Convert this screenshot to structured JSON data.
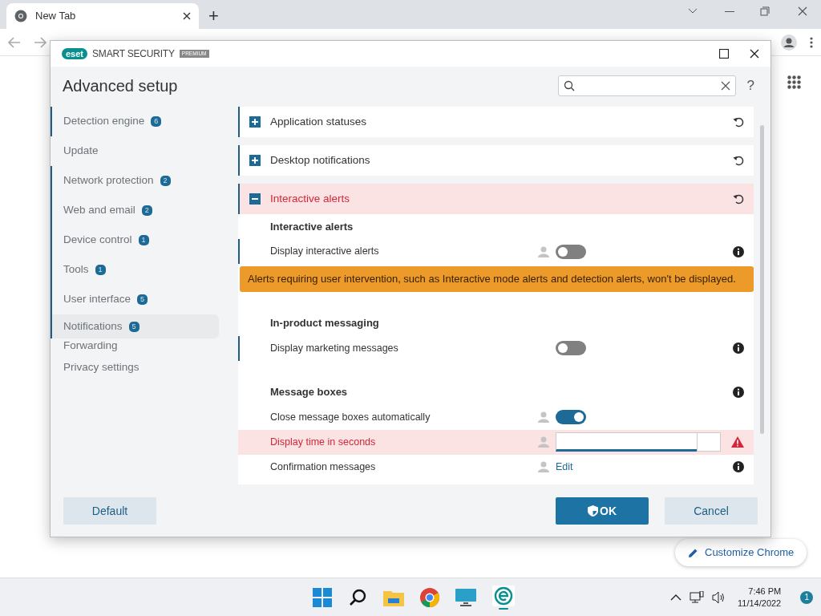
{
  "browser": {
    "tab_title": "New Tab",
    "new_tab": "+",
    "customize_button": "Customize Chrome"
  },
  "dialog": {
    "logo": "eset",
    "product": "SMART SECURITY",
    "edition": "PREMIUM",
    "title": "Advanced setup",
    "help": "?",
    "sidebar": [
      {
        "label": "Detection engine",
        "badge": "6",
        "marked": true,
        "selected": false
      },
      {
        "label": "Update",
        "marked": false,
        "selected": false
      },
      {
        "label": "Network protection",
        "badge": "2",
        "marked": true,
        "selected": false
      },
      {
        "label": "Web and email",
        "badge": "2",
        "marked": true,
        "selected": false
      },
      {
        "label": "Device control",
        "badge": "1",
        "marked": true,
        "selected": false
      },
      {
        "label": "Tools",
        "badge": "1",
        "marked": true,
        "selected": false
      },
      {
        "label": "User interface",
        "badge": "5",
        "marked": true,
        "selected": false
      },
      {
        "label": "Notifications",
        "badge": "5",
        "marked": true,
        "selected": true
      },
      {
        "label": "Forwarding",
        "marked": false,
        "selected": false
      },
      {
        "label": "Privacy settings",
        "marked": false,
        "selected": false
      }
    ],
    "sections": [
      {
        "title": "Application statuses",
        "expanded": false,
        "marked": true,
        "error": false
      },
      {
        "title": "Desktop notifications",
        "expanded": false,
        "marked": true,
        "error": false
      },
      {
        "title": "Interactive alerts",
        "expanded": true,
        "marked": true,
        "error": true,
        "groups": [
          {
            "title": "Interactive alerts",
            "info": false,
            "settings": [
              {
                "label": "Display interactive alerts",
                "kind": "toggle",
                "on": false,
                "marked": true,
                "user_icon": true,
                "info": true,
                "error": false,
                "warning": "Alerts requiring user intervention, such as Interactive mode alerts and detection alerts, won't be displayed."
              }
            ]
          },
          {
            "title": "In-product messaging",
            "info": false,
            "settings": [
              {
                "label": "Display marketing messages",
                "kind": "toggle",
                "on": false,
                "marked": true,
                "user_icon": false,
                "info": true,
                "error": false
              }
            ]
          },
          {
            "title": "Message boxes",
            "info": true,
            "settings": [
              {
                "label": "Close message boxes automatically",
                "kind": "toggle",
                "on": true,
                "marked": false,
                "user_icon": true,
                "info": false,
                "error": false
              },
              {
                "label": "Display time in seconds",
                "kind": "number",
                "marked": false,
                "user_icon": true,
                "info": false,
                "error": true
              },
              {
                "label": "Confirmation messages",
                "kind": "link",
                "link": "Edit",
                "marked": false,
                "user_icon": true,
                "info": true,
                "error": false
              }
            ]
          }
        ]
      }
    ],
    "buttons": [
      {
        "label": "Default",
        "kind": "secondary"
      },
      {
        "label": "OK",
        "kind": "primary"
      },
      {
        "label": "Cancel",
        "kind": "secondary"
      }
    ]
  },
  "taskbar": {
    "time": "7:46 PM",
    "date": "11/14/2022",
    "notifications": "1"
  }
}
